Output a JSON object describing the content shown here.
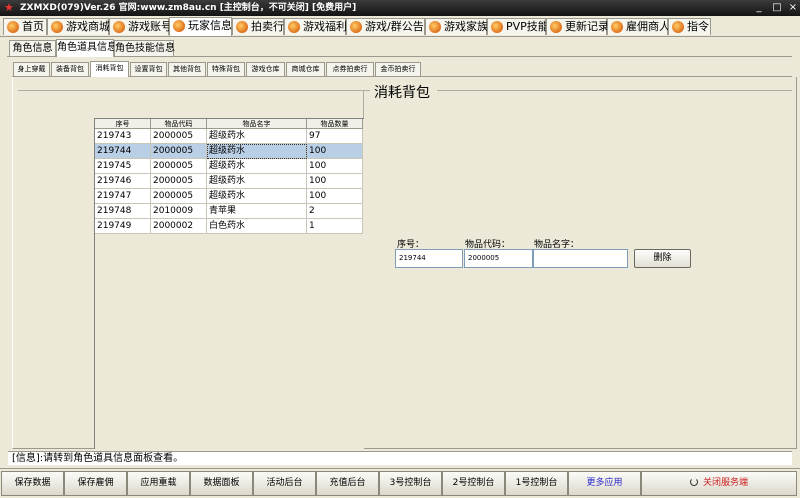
{
  "window": {
    "title": "ZXMXD(079)Ver.26 官网:www.zm8au.cn   [主控制台，不可关闭]  [免费用户]"
  },
  "main_tabs": [
    {
      "label": "首页"
    },
    {
      "label": "游戏商城"
    },
    {
      "label": "游戏账号"
    },
    {
      "label": "玩家信息"
    },
    {
      "label": "拍卖行"
    },
    {
      "label": "游戏福利"
    },
    {
      "label": "游戏/群公告"
    },
    {
      "label": "游戏家族"
    },
    {
      "label": "PVP技能"
    },
    {
      "label": "更新记录"
    },
    {
      "label": "雇佣商人"
    },
    {
      "label": "指令"
    }
  ],
  "sub_tabs": [
    {
      "label": "角色信息"
    },
    {
      "label": "角色道具信息"
    },
    {
      "label": "角色技能信息"
    }
  ],
  "bag_tabs": [
    {
      "label": "身上穿戴"
    },
    {
      "label": "装备背包"
    },
    {
      "label": "消耗背包"
    },
    {
      "label": "设置背包"
    },
    {
      "label": "其他背包"
    },
    {
      "label": "特殊背包"
    },
    {
      "label": "游戏仓库"
    },
    {
      "label": "商城仓库"
    },
    {
      "label": "点券拍卖行"
    },
    {
      "label": "金币拍卖行"
    }
  ],
  "group_title": "消耗背包",
  "table": {
    "headers": [
      "序号",
      "物品代码",
      "物品名字",
      "物品数量"
    ],
    "rows": [
      [
        "219743",
        "2000005",
        "超级药水",
        "97"
      ],
      [
        "219744",
        "2000005",
        "超级药水",
        "100"
      ],
      [
        "219745",
        "2000005",
        "超级药水",
        "100"
      ],
      [
        "219746",
        "2000005",
        "超级药水",
        "100"
      ],
      [
        "219747",
        "2000005",
        "超级药水",
        "100"
      ],
      [
        "219748",
        "2010009",
        "青苹果",
        "2"
      ],
      [
        "219749",
        "2000002",
        "白色药水",
        "1"
      ]
    ],
    "selected_row": 1
  },
  "form": {
    "id_label": "序号：",
    "id_value": "219744",
    "code_label": "物品代码：",
    "code_value": "2000005",
    "name_label": "物品名字：",
    "name_value": "",
    "delete_button": "删除"
  },
  "status": "[信息]:请转到角色道具信息面板查看。",
  "bottom_buttons": [
    {
      "label": "保存数据"
    },
    {
      "label": "保存雇佣"
    },
    {
      "label": "应用重载"
    },
    {
      "label": "数据面板"
    },
    {
      "label": "活动后台"
    },
    {
      "label": "充值后台"
    },
    {
      "label": "3号控制台"
    },
    {
      "label": "2号控制台"
    },
    {
      "label": "1号控制台"
    },
    {
      "label": "更多应用"
    },
    {
      "label": "关闭服务端"
    }
  ],
  "colors": {
    "more_apps": "#2a2acc",
    "close_server": "#cc2222",
    "selection": "#b9cfe6"
  }
}
